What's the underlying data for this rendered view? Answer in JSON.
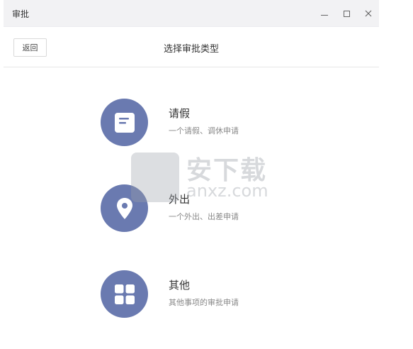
{
  "window": {
    "title": "审批"
  },
  "header": {
    "back_label": "返回",
    "title": "选择审批类型"
  },
  "options": [
    {
      "name": "请假",
      "desc": "一个请假、调休申请",
      "icon": "document-icon"
    },
    {
      "name": "外出",
      "desc": "一个外出、出差申请",
      "icon": "location-pin-icon"
    },
    {
      "name": "其他",
      "desc": "其他事项的审批申请",
      "icon": "grid-icon"
    }
  ],
  "watermark": {
    "text": "安下载",
    "sub": "anxz.com"
  },
  "colors": {
    "icon_circle": "#6a7ab0",
    "titlebar_bg": "#f2f2f4"
  }
}
